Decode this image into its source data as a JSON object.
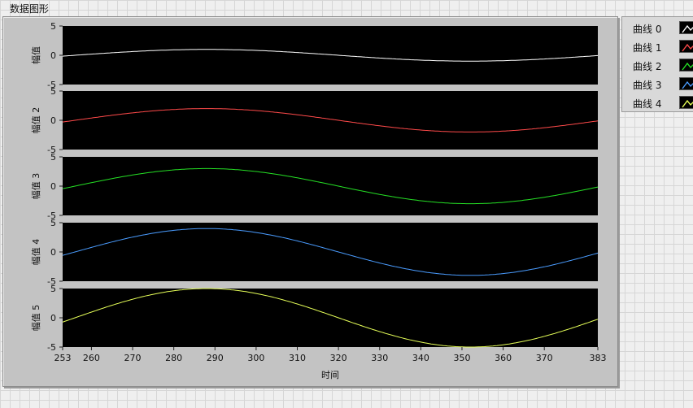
{
  "graph": {
    "title": "数据图形"
  },
  "legend": {
    "items": [
      {
        "label": "曲线 0",
        "color": "#ffffff"
      },
      {
        "label": "曲线 1",
        "color": "#ff4a4a"
      },
      {
        "label": "曲线 2",
        "color": "#25e025"
      },
      {
        "label": "曲线 3",
        "color": "#4a9cff"
      },
      {
        "label": "曲线 4",
        "color": "#e6ff58"
      }
    ]
  },
  "chart_data": {
    "type": "line",
    "xlabel": "时间",
    "xlim": [
      253,
      383
    ],
    "x_ticks": [
      253,
      260,
      270,
      280,
      290,
      300,
      310,
      320,
      330,
      340,
      350,
      360,
      370,
      383
    ],
    "y_ticks": [
      5,
      0,
      -5
    ],
    "ylim": [
      -5,
      5
    ],
    "background": "#000000",
    "grid": false,
    "legend_position": "top-right",
    "plots": [
      {
        "ylabel": "幅值",
        "series": "曲线 0",
        "color": "#ffffff",
        "amplitude": 1,
        "period": 128,
        "phase_x": 256
      },
      {
        "ylabel": "幅值 2",
        "series": "曲线 1",
        "color": "#ff4a4a",
        "amplitude": 2,
        "period": 128,
        "phase_x": 256
      },
      {
        "ylabel": "幅值 3",
        "series": "曲线 2",
        "color": "#25e025",
        "amplitude": 3,
        "period": 128,
        "phase_x": 256
      },
      {
        "ylabel": "幅值 4",
        "series": "曲线 3",
        "color": "#4a9cff",
        "amplitude": 4,
        "period": 128,
        "phase_x": 256
      },
      {
        "ylabel": "幅值 5",
        "series": "曲线 4",
        "color": "#e6ff58",
        "amplitude": 5,
        "period": 128,
        "phase_x": 256
      }
    ]
  }
}
